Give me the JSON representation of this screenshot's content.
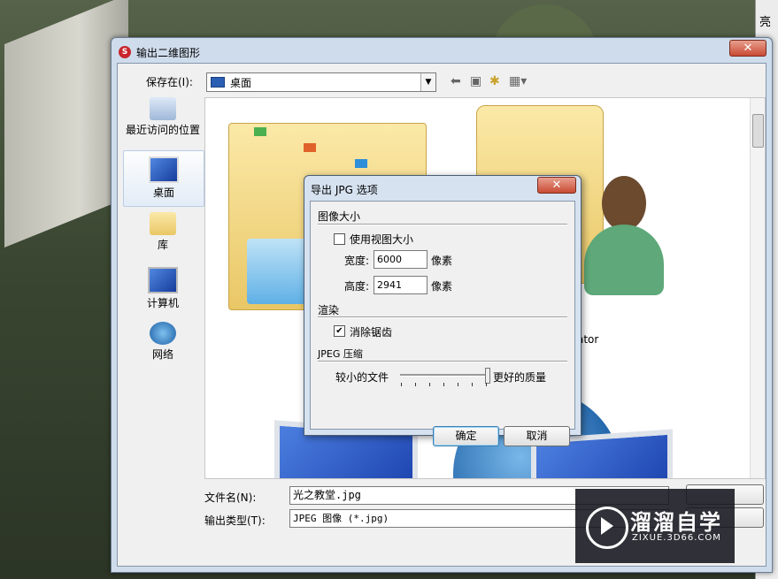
{
  "right_strip": {
    "char": "亮"
  },
  "dialog": {
    "title": "输出二维图形",
    "close": "✕",
    "save_in_label": "保存在(I):",
    "location": "桌面",
    "places": [
      "最近访问的位置",
      "桌面",
      "库",
      "计算机",
      "网络"
    ],
    "file_view": {
      "partial_label": "ator"
    },
    "filename_label": "文件名(N):",
    "filename_value": "光之教堂.jpg",
    "filetype_label": "输出类型(T):",
    "filetype_value": "JPEG 图像 (*.jpg)"
  },
  "options": {
    "title": "导出 JPG 选项",
    "close": "✕",
    "image_size_section": "图像大小",
    "use_view_size_label": "使用视图大小",
    "use_view_size_checked": false,
    "width_label": "宽度:",
    "width_value": "6000",
    "width_unit": "像素",
    "height_label": "高度:",
    "height_value": "2941",
    "height_unit": "像素",
    "render_section": "渲染",
    "antialias_label": "消除锯齿",
    "antialias_checked": true,
    "jpeg_section": "JPEG 压缩",
    "smaller_label": "较小的文件",
    "better_label": "更好的质量",
    "quality_fraction": 1.0,
    "ok_label": "确定",
    "cancel_label": "取消"
  },
  "watermark": {
    "name": "溜溜自学",
    "url": "ZIXUE.3D66.COM"
  }
}
